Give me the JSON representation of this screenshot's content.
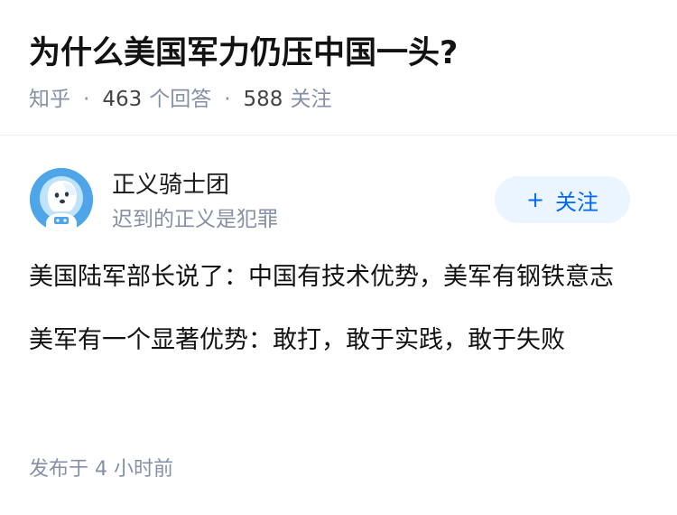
{
  "question": {
    "title": "为什么美国军力仍压中国一头?",
    "source": "知乎",
    "separator": "·",
    "answers_count": "463",
    "answers_label": "个回答",
    "followers_count": "588",
    "followers_label": "关注"
  },
  "answer": {
    "author_name": "正义骑士团",
    "author_bio": "迟到的正义是犯罪",
    "follow_button": {
      "plus": "+",
      "label": "关注"
    },
    "paragraphs": [
      "美国陆军部长说了：中国有技术优势，美军有钢铁意志",
      "美军有一个显著优势：敢打，敢于实践，敢于失败"
    ],
    "published": "发布于 4 小时前"
  },
  "colors": {
    "accent": "#0066ff",
    "follow_bg": "#ebf5ff",
    "meta_gray": "#8590a6",
    "avatar_blue": "#4ea6e8"
  }
}
